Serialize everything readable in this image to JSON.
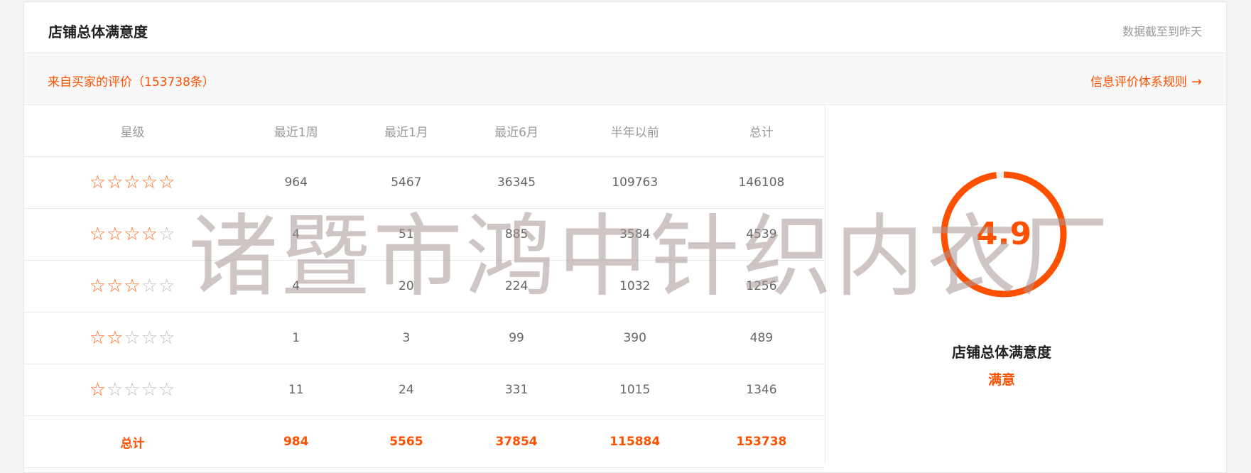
{
  "header": {
    "title": "店铺总体满意度",
    "note": "数据截至到昨天"
  },
  "subheader": {
    "from_buyers": "来自买家的评价（153738条）",
    "rules_link": "信息评价体系规则"
  },
  "table": {
    "headers": [
      "星级",
      "最近1周",
      "最近1月",
      "最近6月",
      "半年以前",
      "总计"
    ],
    "rows": [
      {
        "stars": 5,
        "values": [
          "964",
          "5467",
          "36345",
          "109763",
          "146108"
        ]
      },
      {
        "stars": 4,
        "values": [
          "4",
          "51",
          "885",
          "3584",
          "4539"
        ]
      },
      {
        "stars": 3,
        "values": [
          "4",
          "20",
          "224",
          "1032",
          "1256"
        ]
      },
      {
        "stars": 2,
        "values": [
          "1",
          "3",
          "99",
          "390",
          "489"
        ]
      },
      {
        "stars": 1,
        "values": [
          "11",
          "24",
          "331",
          "1015",
          "1346"
        ]
      }
    ],
    "total": {
      "label": "总计",
      "values": [
        "984",
        "5565",
        "37854",
        "115884",
        "153738"
      ]
    }
  },
  "score": {
    "value": "4.9",
    "fraction": 0.98,
    "title": "店铺总体满意度",
    "level": "满意"
  },
  "watermark": "诸暨市鸿中针织内衣厂",
  "colors": {
    "accent": "#ff5000",
    "star_on": "#ff6a1a",
    "star_off": "#bdbdbd"
  }
}
